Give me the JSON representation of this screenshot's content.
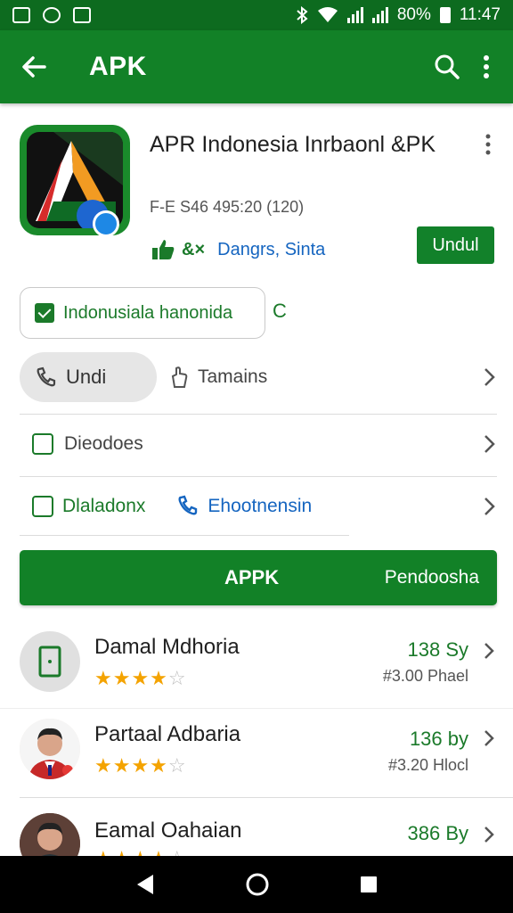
{
  "status_bar": {
    "battery": "80%",
    "time": "11:47"
  },
  "app_bar": {
    "title": "APK"
  },
  "app": {
    "name": "APR Indonesia Inrbaonl &PK",
    "meta": "F-E S46  495:20 (120)",
    "rating_text": "&×",
    "category": "Dangrs, Sinta",
    "install_label": "Undul"
  },
  "verified": {
    "label": "Indonusiala hanonida",
    "suffix": "C"
  },
  "actions": {
    "pill_label": "Undi",
    "second_label": "Tamains",
    "row2_label": "Dieodoes",
    "row3_left": "Dlaladonx",
    "row3_right": "Ehootnensin"
  },
  "banner": {
    "left": "APPK",
    "right": "Pendoosha"
  },
  "list": [
    {
      "name": "Damal Mdhoria",
      "rating": 4,
      "size": "138 Sy",
      "price": "#3.00 Phael"
    },
    {
      "name": "Partaal Adbaria",
      "rating": 4,
      "size": "136 by",
      "price": "#3.20 Hlocl"
    },
    {
      "name": "Eamal Oahaian",
      "rating": 4,
      "size": "386 By",
      "price": ""
    }
  ],
  "colors": {
    "primary": "#128127",
    "status": "#0d6b1f",
    "accent_blue": "#1565c0",
    "star": "#f4a300"
  }
}
